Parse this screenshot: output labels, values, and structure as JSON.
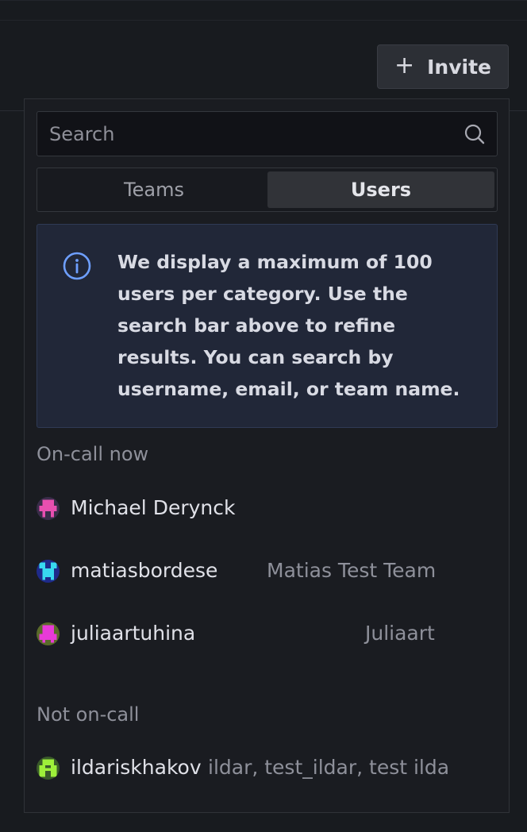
{
  "header": {
    "invite_label": "Invite"
  },
  "search": {
    "placeholder": "Search"
  },
  "tabs": [
    {
      "label": "Teams",
      "selected": false
    },
    {
      "label": "Users",
      "selected": true
    }
  ],
  "alert": {
    "text": "We display a maximum of 100 users per category. Use the search bar above to refine results. You can search by username, email, or team name."
  },
  "sections": {
    "oncall_title": "On-call now",
    "not_oncall_title": "Not on-call"
  },
  "oncall_users": [
    {
      "name": "Michael Derynck",
      "team": ""
    },
    {
      "name": "matiasbordese",
      "team": "Matias Test Team"
    },
    {
      "name": "juliaartuhina",
      "team": "Juliaart"
    }
  ],
  "not_oncall_users": [
    {
      "name": "ildariskhakov",
      "team": "ildar, test_ildar, test ilda"
    }
  ],
  "colors": {
    "background": "#181b1f",
    "panel": "#1a1c21",
    "alert_bg": "#212738",
    "info_blue": "#6e9fff"
  }
}
